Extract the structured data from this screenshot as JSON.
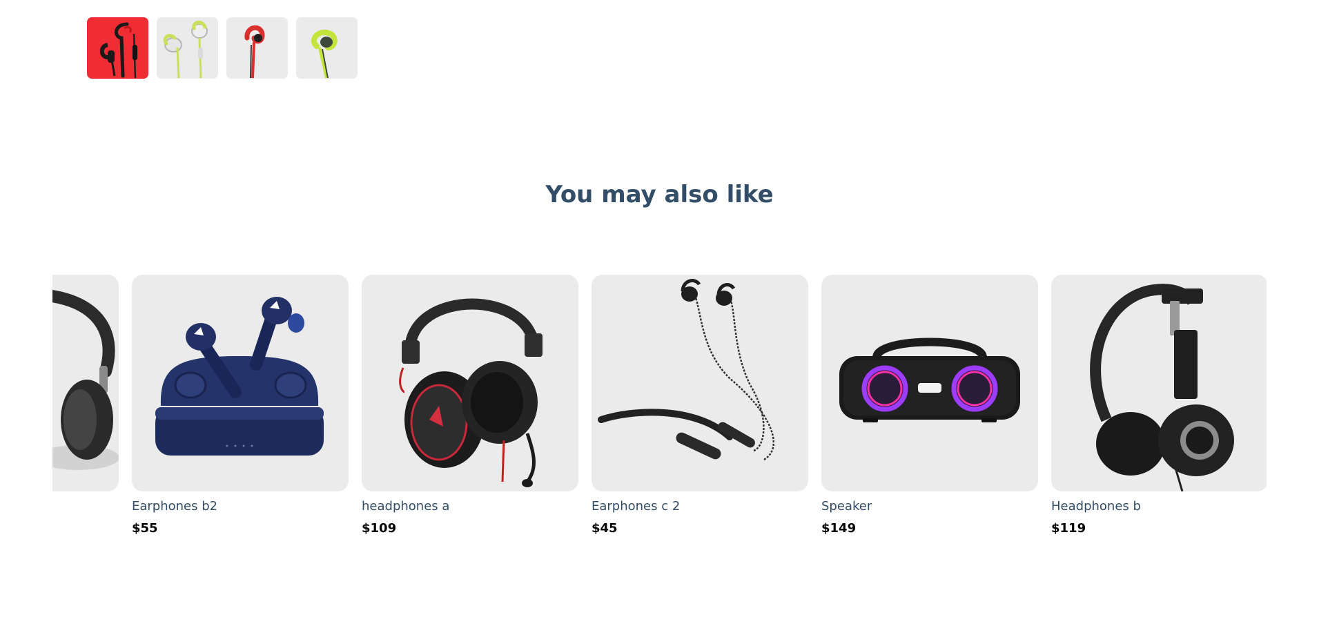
{
  "product_gallery": {
    "thumbnails": [
      {
        "icon": "earphones-black-red-icon",
        "selected": true
      },
      {
        "icon": "earphones-white-green-icon",
        "selected": false
      },
      {
        "icon": "earphone-red-icon",
        "selected": false
      },
      {
        "icon": "earphone-lime-icon",
        "selected": false
      }
    ]
  },
  "recommendations": {
    "heading": "You may also like",
    "products": [
      {
        "name": "",
        "price": "",
        "icon": "headphones-partial-icon"
      },
      {
        "name": "Earphones b2",
        "price": "$55",
        "icon": "wireless-earbuds-case-icon"
      },
      {
        "name": "headphones a",
        "price": "$109",
        "icon": "gaming-headset-icon"
      },
      {
        "name": "Earphones c 2",
        "price": "$45",
        "icon": "neckband-earphones-icon"
      },
      {
        "name": "Speaker",
        "price": "$149",
        "icon": "boombox-speaker-icon"
      },
      {
        "name": "Headphones b",
        "price": "$119",
        "icon": "on-ear-headphones-icon"
      }
    ]
  },
  "colors": {
    "accent": "#f02d34",
    "heading": "#324d67",
    "card_background": "#ebebeb",
    "price": "#000000"
  }
}
